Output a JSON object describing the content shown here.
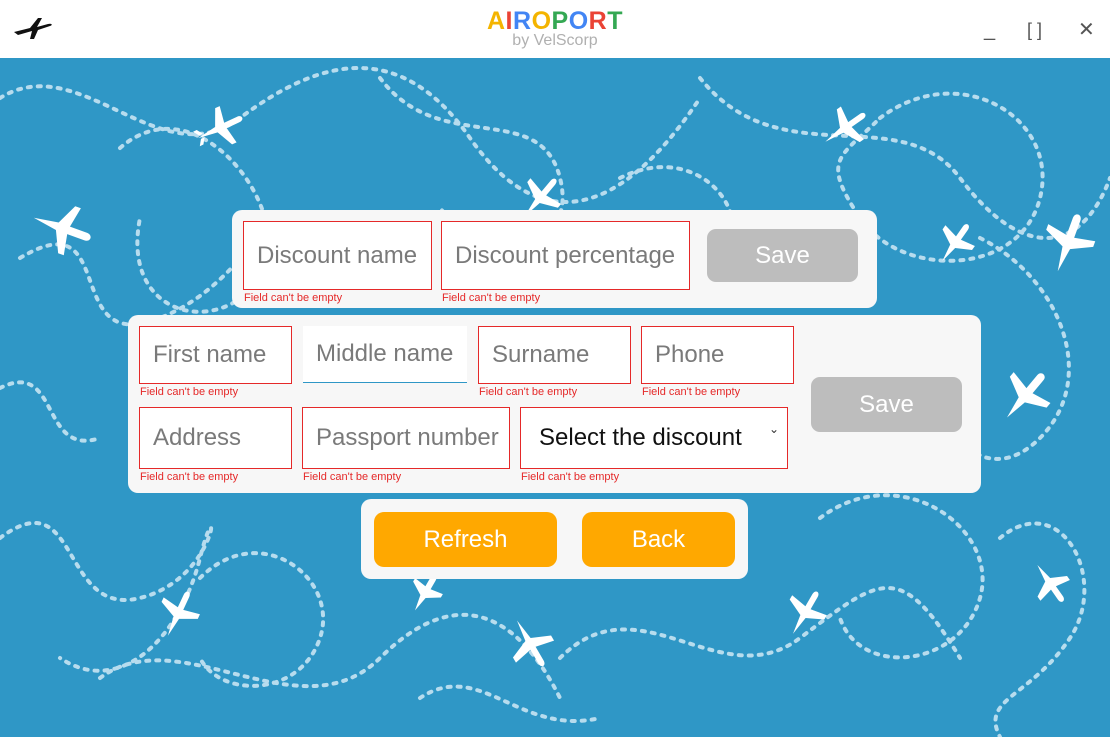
{
  "titlebar": {
    "brand_title": "AIROPORT",
    "brand_subtitle": "by VelScorp",
    "minimize_label": "_",
    "maximize_label": "[ ]",
    "close_label": "✕",
    "brand_colors": [
      "#f4b400",
      "#ea4335",
      "#4285f4",
      "#f4b400",
      "#34a853",
      "#4285f4",
      "#ea4335",
      "#34a853"
    ]
  },
  "discount_form": {
    "name_placeholder": "Discount name",
    "percentage_placeholder": "Discount percentage",
    "save_label": "Save",
    "name_error": "Field can't be empty",
    "percentage_error": "Field can't be empty"
  },
  "client_form": {
    "first_name_placeholder": "First name",
    "middle_name_placeholder": "Middle name",
    "surname_placeholder": "Surname",
    "phone_placeholder": "Phone",
    "address_placeholder": "Address",
    "passport_placeholder": "Passport number",
    "discount_select": "Select the discount",
    "save_label": "Save",
    "first_name_error": "Field can't be empty",
    "surname_error": "Field can't be empty",
    "phone_error": "Field can't be empty",
    "address_error": "Field can't be empty",
    "passport_error": "Field can't be empty",
    "discount_error": "Field can't be empty"
  },
  "actions": {
    "refresh_label": "Refresh",
    "back_label": "Back"
  },
  "colors": {
    "background": "#2f97c6",
    "error": "#e52929",
    "accent": "#ffa800",
    "disabled": "#bdbdbd"
  }
}
